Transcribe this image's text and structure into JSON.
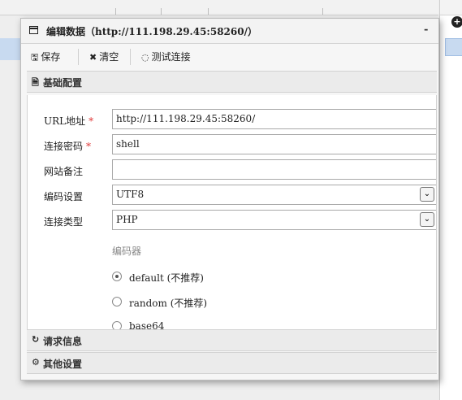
{
  "dialog": {
    "title": "编辑数据（http://111.198.29.45:58260/）",
    "minimize_glyph": "-"
  },
  "toolbar": {
    "save_label": "保存",
    "clear_label": "清空",
    "test_label": "测试连接"
  },
  "sections": {
    "basic": "基础配置",
    "request": "请求信息",
    "other": "其他设置"
  },
  "form": {
    "url_label": "URL地址",
    "url_value": "http://111.198.29.45:58260/",
    "password_label": "连接密码",
    "password_value": "shell",
    "note_label": "网站备注",
    "note_value": "",
    "encoding_label": "编码设置",
    "encoding_value": "UTF8",
    "type_label": "连接类型",
    "type_value": "PHP",
    "required_mark": "*"
  },
  "encoder": {
    "title": "编码器",
    "options": [
      {
        "label": "default (不推荐)",
        "checked": true
      },
      {
        "label": "random (不推荐)",
        "checked": false
      },
      {
        "label": "base64",
        "checked": false
      }
    ]
  },
  "icons": {
    "title": "window-icon",
    "save": "floppy-icon",
    "clear": "x-icon",
    "test": "spinner-icon",
    "basic": "file-icon",
    "request": "refresh-icon",
    "other": "gears-icon",
    "dropdown": "chevron-down-icon"
  }
}
